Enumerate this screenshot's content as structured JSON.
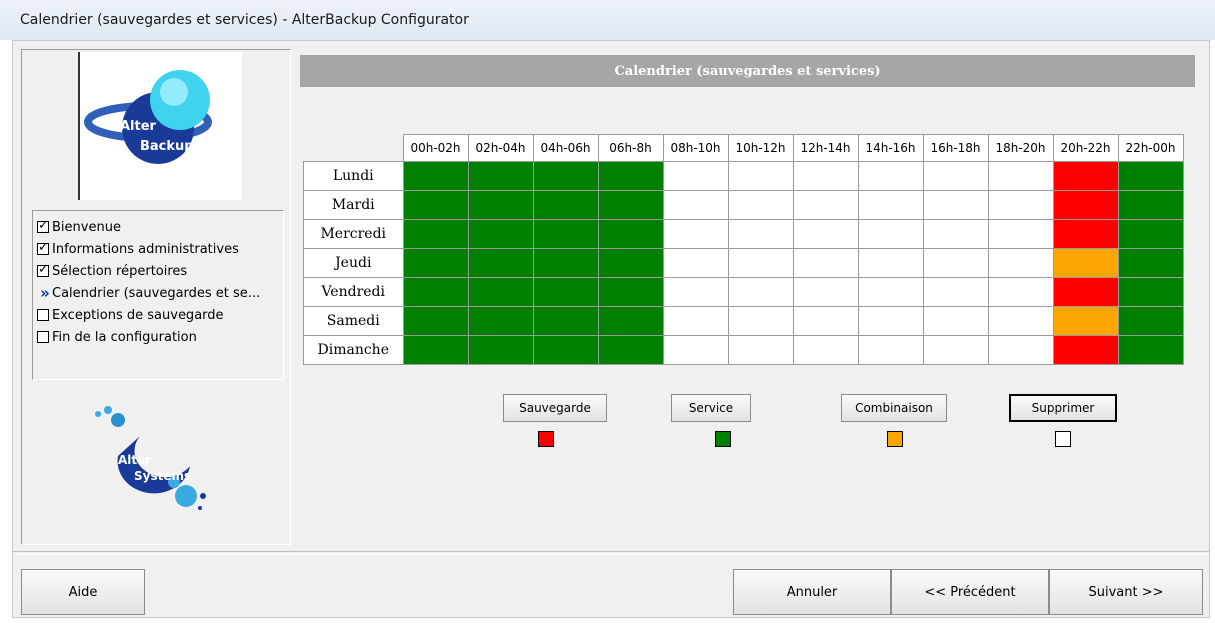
{
  "window": {
    "title": "Calendrier (sauvegardes et services) - AlterBackup Configurator"
  },
  "logos": {
    "top_text_1": "Alter",
    "top_text_2": "Backup",
    "bottom_text_1": "Alter",
    "bottom_text_2": "Systems"
  },
  "steps": [
    {
      "label": "Bienvenue",
      "state": "checked"
    },
    {
      "label": "Informations administratives",
      "state": "checked"
    },
    {
      "label": "Sélection répertoires",
      "state": "checked"
    },
    {
      "label": "Calendrier (sauvegardes et se...",
      "state": "current"
    },
    {
      "label": "Exceptions de sauvegarde",
      "state": "unchecked"
    },
    {
      "label": "Fin de la configuration",
      "state": "unchecked"
    }
  ],
  "calendar": {
    "title": "Calendrier (sauvegardes et services)",
    "columns": [
      "00h-02h",
      "02h-04h",
      "04h-06h",
      "06h-8h",
      "08h-10h",
      "10h-12h",
      "12h-14h",
      "14h-16h",
      "16h-18h",
      "18h-20h",
      "20h-22h",
      "22h-00h"
    ],
    "days": [
      "Lundi",
      "Mardi",
      "Mercredi",
      "Jeudi",
      "Vendredi",
      "Samedi",
      "Dimanche"
    ],
    "cells": [
      [
        "service",
        "service",
        "service",
        "service",
        "empty",
        "empty",
        "empty",
        "empty",
        "empty",
        "empty",
        "sauvegarde",
        "service"
      ],
      [
        "service",
        "service",
        "service",
        "service",
        "empty",
        "empty",
        "empty",
        "empty",
        "empty",
        "empty",
        "sauvegarde",
        "service"
      ],
      [
        "service",
        "service",
        "service",
        "service",
        "empty",
        "empty",
        "empty",
        "empty",
        "empty",
        "empty",
        "sauvegarde",
        "service"
      ],
      [
        "service",
        "service",
        "service",
        "service",
        "empty",
        "empty",
        "empty",
        "empty",
        "empty",
        "empty",
        "combinaison",
        "service"
      ],
      [
        "service",
        "service",
        "service",
        "service",
        "empty",
        "empty",
        "empty",
        "empty",
        "empty",
        "empty",
        "sauvegarde",
        "service"
      ],
      [
        "service",
        "service",
        "service",
        "service",
        "empty",
        "empty",
        "empty",
        "empty",
        "empty",
        "empty",
        "combinaison",
        "service"
      ],
      [
        "service",
        "service",
        "service",
        "service",
        "empty",
        "empty",
        "empty",
        "empty",
        "empty",
        "empty",
        "sauvegarde",
        "service"
      ]
    ],
    "colors": {
      "sauvegarde": "#ff0000",
      "service": "#008000",
      "combinaison": "#ffa500",
      "empty": "#ffffff"
    }
  },
  "legend": {
    "sauvegarde": "Sauvegarde",
    "service": "Service",
    "combinaison": "Combinaison",
    "supprimer": "Supprimer"
  },
  "footer": {
    "help": "Aide",
    "cancel": "Annuler",
    "previous": "<< Précédent",
    "next": "Suivant >>"
  }
}
